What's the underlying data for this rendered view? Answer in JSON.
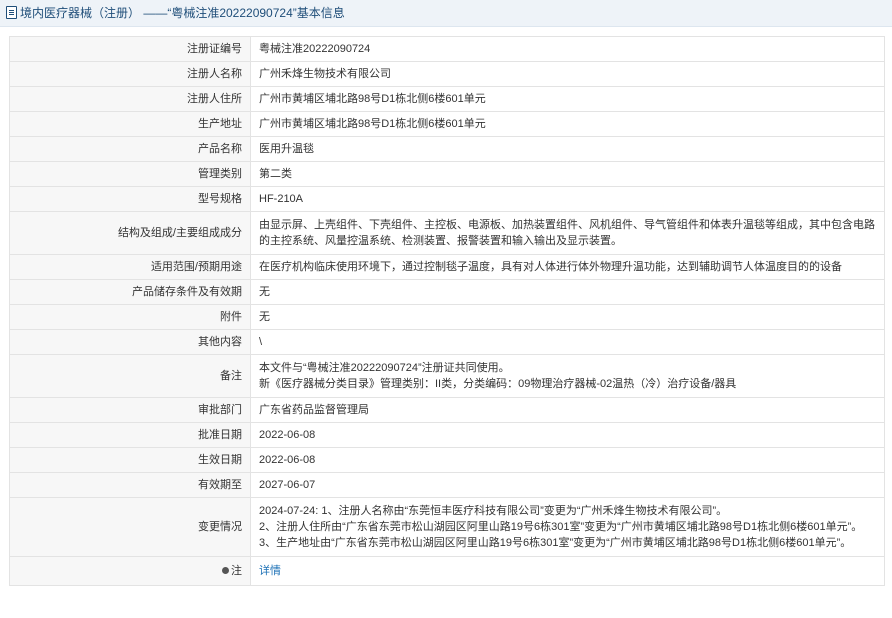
{
  "header": {
    "title": "境内医疗器械（注册） ——“粤械注准20222090724”基本信息"
  },
  "rows": {
    "reg_no": {
      "label": "注册证编号",
      "value": "粤械注准20222090724"
    },
    "registrant": {
      "label": "注册人名称",
      "value": "广州禾烽生物技术有限公司"
    },
    "registrant_addr": {
      "label": "注册人住所",
      "value": "广州市黄埔区埔北路98号D1栋北侧6楼601单元"
    },
    "production_addr": {
      "label": "生产地址",
      "value": "广州市黄埔区埔北路98号D1栋北侧6楼601单元"
    },
    "product_name": {
      "label": "产品名称",
      "value": "医用升温毯"
    },
    "mgmt_class": {
      "label": "管理类别",
      "value": "第二类"
    },
    "model": {
      "label": "型号规格",
      "value": "HF-210A"
    },
    "structure": {
      "label": "结构及组成/主要组成成分",
      "value": "由显示屏、上壳组件、下壳组件、主控板、电源板、加热装置组件、风机组件、导气管组件和体表升温毯等组成，其中包含电路的主控系统、风量控温系统、检测装置、报警装置和输入输出及显示装置。"
    },
    "scope": {
      "label": "适用范围/预期用途",
      "value": "在医疗机构临床使用环境下，通过控制毯子温度，具有对人体进行体外物理升温功能，达到辅助调节人体温度目的的设备"
    },
    "storage": {
      "label": "产品储存条件及有效期",
      "value": "无"
    },
    "attachment": {
      "label": "附件",
      "value": "无"
    },
    "other": {
      "label": "其他内容",
      "value": "\\"
    },
    "remarks": {
      "label": "备注",
      "line1": "本文件与“粤械注准20222090724”注册证共同使用。",
      "line2": "新《医疗器械分类目录》管理类别：II类，分类编码：09物理治疗器械-02温热（冷）治疗设备/器具"
    },
    "dept": {
      "label": "审批部门",
      "value": "广东省药品监督管理局"
    },
    "approval_date": {
      "label": "批准日期",
      "value": "2022-06-08"
    },
    "effective_date": {
      "label": "生效日期",
      "value": "2022-06-08"
    },
    "expiry_date": {
      "label": "有效期至",
      "value": "2027-06-07"
    },
    "changes": {
      "label": "变更情况",
      "line1": "2024-07-24: 1、注册人名称由“东莞恒丰医疗科技有限公司”变更为“广州禾烽生物技术有限公司”。",
      "line2": "2、注册人住所由“广东省东莞市松山湖园区阿里山路19号6栋301室”变更为“广州市黄埔区埔北路98号D1栋北侧6楼601单元”。",
      "line3": "3、生产地址由“广东省东莞市松山湖园区阿里山路19号6栋301室”变更为“广州市黄埔区埔北路98号D1栋北侧6楼601单元”。"
    },
    "note": {
      "label": "注",
      "link": "详情"
    }
  }
}
